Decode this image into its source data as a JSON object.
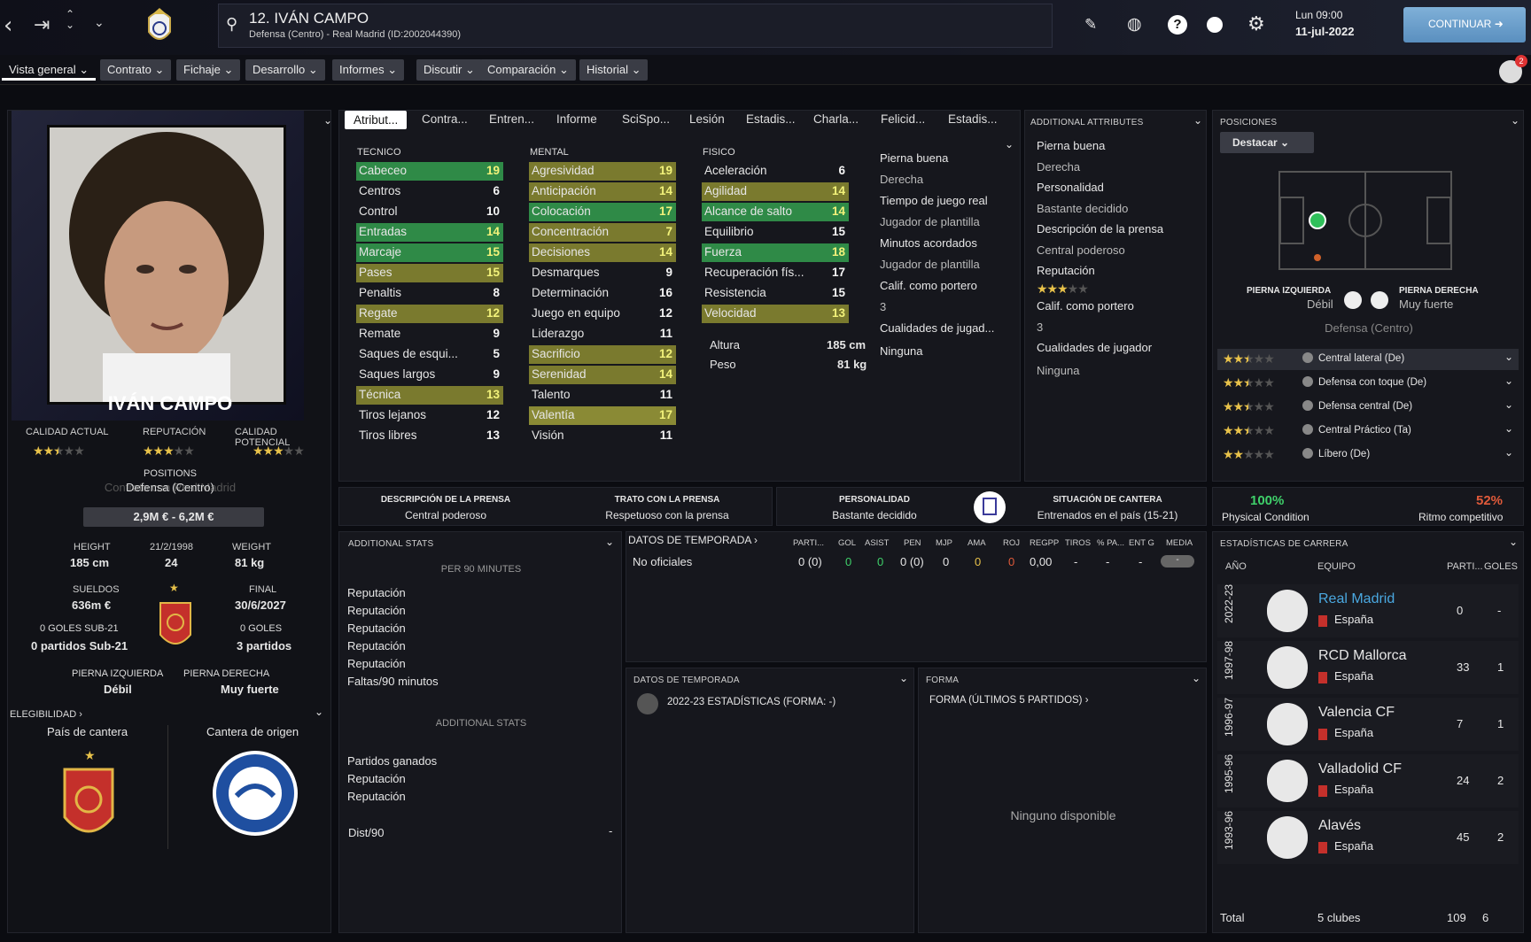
{
  "player": {
    "title": "12. IVÁN CAMPO",
    "subtitle": "Defensa (Centro) - Real Madrid (ID:2002044390)",
    "name": "IVÁN CAMPO"
  },
  "clock": {
    "day": "Lun 09:00",
    "date": "11-jul-2022"
  },
  "continue_label": "CONTINUAR",
  "notif_count": "2",
  "menu": [
    "Vista general",
    "Contrato",
    "Fichaje",
    "Desarrollo",
    "Informes",
    "Discutir",
    "Comparación",
    "Historial"
  ],
  "tabs": [
    "Atribut...",
    "Contra...",
    "Entren...",
    "Informe",
    "SciSpo...",
    "Lesión",
    "Estadis...",
    "Charla...",
    "Felicid...",
    "Estadis..."
  ],
  "left": {
    "calidad_actual": "CALIDAD ACTUAL",
    "reputacion": "REPUTACIÓN",
    "calidad_potencial": "CALIDAD POTENCIAL",
    "ca_stars": 2.5,
    "rep_stars": 3,
    "cp_stars": 3,
    "positions": "POSITIONS",
    "position_val": "Defensa (Centro)",
    "ghost_text": "Contrato con Real Madrid",
    "value": "2,9M € - 6,2M €",
    "height_l": "HEIGHT",
    "height_v": "185 cm",
    "dob": "21/2/1998",
    "age": "24",
    "weight_l": "WEIGHT",
    "weight_v": "81 kg",
    "sueldos_l": "SUELDOS",
    "sueldos_v": "636m €",
    "final_l": "FINAL",
    "final_v": "30/6/2027",
    "goles_sub21": "0 GOLES SUB-21",
    "partidos_sub21": "0 partidos Sub-21",
    "goles": "0 GOLES",
    "partidos": "3 partidos",
    "pi_l": "PIERNA IZQUIERDA",
    "pi_v": "Débil",
    "pd_l": "PIERNA DERECHA",
    "pd_v": "Muy fuerte",
    "elegibilidad": "ELEGIBILIDAD",
    "pais_cantera": "País de cantera",
    "cantera_origen": "Cantera de origen"
  },
  "attr": {
    "tecnico_h": "TECNICO",
    "mental_h": "MENTAL",
    "fisico_h": "FISICO",
    "tecnico": [
      [
        "Cabeceo",
        "19",
        "g"
      ],
      [
        "Centros",
        "6",
        ""
      ],
      [
        "Control",
        "10",
        ""
      ],
      [
        "Entradas",
        "14",
        "g"
      ],
      [
        "Marcaje",
        "15",
        "g"
      ],
      [
        "Pases",
        "15",
        "o"
      ],
      [
        "Penaltis",
        "8",
        ""
      ],
      [
        "Regate",
        "12",
        "o"
      ],
      [
        "Remate",
        "9",
        ""
      ],
      [
        "Saques de esqui...",
        "5",
        ""
      ],
      [
        "Saques largos",
        "9",
        ""
      ],
      [
        "Técnica",
        "13",
        "o"
      ],
      [
        "Tiros lejanos",
        "12",
        ""
      ],
      [
        "Tiros libres",
        "13",
        ""
      ]
    ],
    "mental": [
      [
        "Agresividad",
        "19",
        "o"
      ],
      [
        "Anticipación",
        "14",
        "o"
      ],
      [
        "Colocación",
        "17",
        "g"
      ],
      [
        "Concentración",
        "7",
        "o"
      ],
      [
        "Decisiones",
        "14",
        "o"
      ],
      [
        "Desmarques",
        "9",
        ""
      ],
      [
        "Determinación",
        "16",
        ""
      ],
      [
        "Juego en equipo",
        "12",
        ""
      ],
      [
        "Liderazgo",
        "11",
        ""
      ],
      [
        "Sacrificio",
        "12",
        "o"
      ],
      [
        "Serenidad",
        "14",
        "o"
      ],
      [
        "Talento",
        "11",
        ""
      ],
      [
        "Valentía",
        "17",
        "y"
      ],
      [
        "Visión",
        "11",
        ""
      ]
    ],
    "fisico": [
      [
        "Aceleración",
        "6",
        ""
      ],
      [
        "Agilidad",
        "14",
        "o"
      ],
      [
        "Alcance de salto",
        "14",
        "g"
      ],
      [
        "Equilibrio",
        "15",
        ""
      ],
      [
        "Fuerza",
        "18",
        "g"
      ],
      [
        "Recuperación fís...",
        "17",
        ""
      ],
      [
        "Resistencia",
        "15",
        ""
      ],
      [
        "Velocidad",
        "13",
        "o"
      ]
    ],
    "altura_l": "Altura",
    "altura_v": "185 cm",
    "peso_l": "Peso",
    "peso_v": "81 kg"
  },
  "mid_info": [
    "Pierna buena",
    "Derecha",
    "Tiempo de juego real",
    "Jugador de plantilla",
    "Minutos acordados",
    "Jugador de plantilla",
    "Calif. como portero",
    "3",
    "Cualidades de jugad...",
    "Ninguna"
  ],
  "additional": {
    "title": "ADDITIONAL ATTRIBUTES",
    "items": [
      "Pierna buena",
      "Derecha",
      "Personalidad",
      "Bastante decidido",
      "Descripción de la prensa",
      "Central poderoso",
      "Reputación"
    ],
    "rep_stars": 3,
    "items2": [
      "Calif. como portero",
      "3",
      "Cualidades de jugador",
      "Ninguna"
    ]
  },
  "posiciones": {
    "title": "POSICIONES",
    "btn": "Destacar",
    "pi_l": "PIERNA IZQUIERDA",
    "pi_v": "Débil",
    "pd_l": "PIERNA DERECHA",
    "pd_v": "Muy fuerte",
    "main": "Defensa (Centro)",
    "roles": [
      [
        "Central lateral (De)",
        2.5
      ],
      [
        "Defensa con toque (De)",
        2.5
      ],
      [
        "Defensa central (De)",
        2.5
      ],
      [
        "Central Práctico (Ta)",
        2.5
      ],
      [
        "Líbero (De)",
        2
      ]
    ]
  },
  "press": {
    "desc_l": "DESCRIPCIÓN DE LA PRENSA",
    "desc_v": "Central poderoso",
    "trato_l": "TRATO CON LA PRENSA",
    "trato_v": "Respetuoso con la prensa",
    "pers_l": "PERSONALIDAD",
    "pers_v": "Bastante decidido",
    "cant_l": "SITUACIÓN DE CANTERA",
    "cant_v": "Entrenados en el país (15-21)"
  },
  "condition": {
    "pc_v": "100%",
    "pc_l": "Physical Condition",
    "rc_v": "52%",
    "rc_l": "Ritmo competitivo"
  },
  "addstats": {
    "title": "ADDITIONAL STATS",
    "per90": "PER 90 MINUTES",
    "list1": [
      "Reputación",
      "Reputación",
      "Reputación",
      "Reputación",
      "Reputación",
      "Faltas/90 minutos"
    ],
    "sub": "ADDITIONAL STATS",
    "list2": [
      "Partidos ganados",
      "Reputación",
      "Reputación"
    ],
    "dist": "Dist/90",
    "dist_v": "-"
  },
  "season": {
    "title": "DATOS DE TEMPORADA",
    "cols": [
      "PARTI...",
      "GOL",
      "ASIST",
      "PEN",
      "MJP",
      "AMA",
      "ROJ",
      "REGPP",
      "TIROS",
      "% PA...",
      "ENT G",
      "MEDIA"
    ],
    "row_label": "No oficiales",
    "row": [
      "0 (0)",
      "0",
      "0",
      "0 (0)",
      "0",
      "0",
      "0",
      "0,00",
      "-",
      "-",
      "-",
      "-"
    ]
  },
  "season2": {
    "title": "DATOS DE TEMPORADA",
    "text": "2022-23 ESTADÍSTICAS (FORMA: -)"
  },
  "forma": {
    "title": "FORMA",
    "sub": "FORMA (ÚLTIMOS 5 PARTIDOS)",
    "none": "Ninguno disponible"
  },
  "career": {
    "title": "ESTADÍSTICAS DE CARRERA",
    "cols": [
      "AÑO",
      "EQUIPO",
      "PARTI...",
      "GOLES"
    ],
    "rows": [
      [
        "2022-23",
        "Real Madrid",
        "España",
        "0",
        "-"
      ],
      [
        "1997-98",
        "RCD Mallorca",
        "España",
        "33",
        "1"
      ],
      [
        "1996-97",
        "Valencia CF",
        "España",
        "7",
        "1"
      ],
      [
        "1995-96",
        "Valladolid CF",
        "España",
        "24",
        "2"
      ],
      [
        "1993-96",
        "Alavés",
        "España",
        "45",
        "2"
      ]
    ],
    "total_l": "Total",
    "total_clubs": "5 clubes",
    "total_apps": "109",
    "total_goals": "6"
  },
  "colors": {
    "green": "#2f8a47",
    "olive": "#7a7a2e",
    "accent": "#4aa8e0",
    "star": "#e8c24a"
  }
}
